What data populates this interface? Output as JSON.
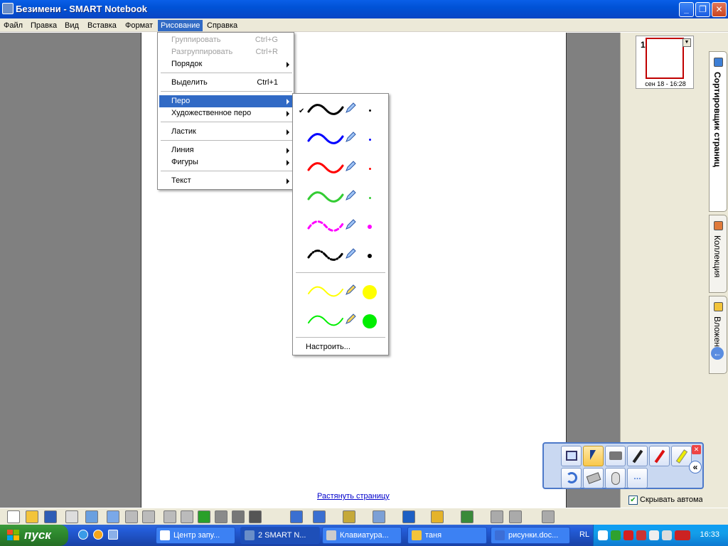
{
  "window": {
    "title": "Безимени - SMART Notebook"
  },
  "menubar": [
    "Файл",
    "Правка",
    "Вид",
    "Вставка",
    "Формат",
    "Рисование",
    "Справка"
  ],
  "draw_menu": {
    "items": [
      {
        "label": "Группировать",
        "shortcut": "Ctrl+G",
        "disabled": true
      },
      {
        "label": "Разгруппировать",
        "shortcut": "Ctrl+R",
        "disabled": true
      },
      {
        "label": "Порядок",
        "submenu": true
      },
      {
        "label": "Выделить",
        "shortcut": "Ctrl+1"
      },
      {
        "label": "Перо",
        "submenu": true,
        "highlighted": true
      },
      {
        "label": "Художественное перо",
        "submenu": true
      },
      {
        "label": "Ластик",
        "submenu": true
      },
      {
        "label": "Линия",
        "submenu": true
      },
      {
        "label": "Фигуры",
        "submenu": true
      },
      {
        "label": "Текст",
        "submenu": true
      }
    ]
  },
  "pen_submenu": {
    "check_mark": "✔",
    "pens": [
      {
        "color": "#000000",
        "style": "solid",
        "selected": true
      },
      {
        "color": "#0000ff",
        "style": "solid"
      },
      {
        "color": "#ff0000",
        "style": "solid"
      },
      {
        "color": "#33cc33",
        "style": "solid"
      },
      {
        "color": "#ff00ff",
        "style": "dashed"
      },
      {
        "color": "#000000",
        "style": "dash-dot"
      },
      {
        "color": "#ffff00",
        "style": "highlighter"
      },
      {
        "color": "#00ee00",
        "style": "highlighter"
      }
    ],
    "customize_label": "Настроить..."
  },
  "page_sorter": {
    "page_number": "1",
    "caption": "сен 18 - 16:28"
  },
  "side_tabs": {
    "sorter": "Сортировщик страниц",
    "gallery": "Коллекция",
    "attachments": "Вложения"
  },
  "canvas": {
    "stretch_link": "Растянуть страницу"
  },
  "autohide": {
    "checked": true,
    "label": "Скрывать автома"
  },
  "taskbar": {
    "start": "пуск",
    "tasks": [
      "Центр запу...",
      "2 SMART N...",
      "Клавиатура...",
      "таня",
      "рисунки.doc..."
    ],
    "lang": "RL",
    "clock": "16:33"
  },
  "icons": {
    "window_icon": "smart-notebook-icon",
    "check_icon": "check-icon",
    "pen_icon": "pen-icon",
    "arrow_back": "back-arrow-icon"
  }
}
